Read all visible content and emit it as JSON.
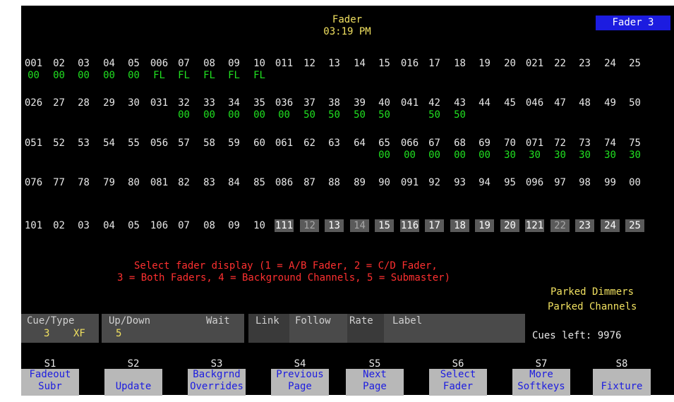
{
  "header": {
    "title": "Fader",
    "time": "03:19 PM",
    "badge": "Fader 3"
  },
  "rows": [
    {
      "channels": [
        "001",
        "02",
        "03",
        "04",
        "05",
        "006",
        "07",
        "08",
        "09",
        "10",
        "011",
        "12",
        "13",
        "14",
        "15",
        "016",
        "17",
        "18",
        "19",
        "20",
        "021",
        "22",
        "23",
        "24",
        "25"
      ],
      "levels": [
        "00",
        "00",
        "00",
        "00",
        "00",
        "FL",
        "FL",
        "FL",
        "FL",
        "FL",
        "",
        "",
        "",
        "",
        "",
        "",
        "",
        "",
        "",
        "",
        "",
        "",
        "",
        "",
        ""
      ]
    },
    {
      "channels": [
        "026",
        "27",
        "28",
        "29",
        "30",
        "031",
        "32",
        "33",
        "34",
        "35",
        "036",
        "37",
        "38",
        "39",
        "40",
        "041",
        "42",
        "43",
        "44",
        "45",
        "046",
        "47",
        "48",
        "49",
        "50"
      ],
      "levels": [
        "",
        "",
        "",
        "",
        "",
        "",
        "00",
        "00",
        "00",
        "00",
        "00",
        "50",
        "50",
        "50",
        "50",
        "",
        "50",
        "50",
        "",
        "",
        "",
        "",
        "",
        "",
        ""
      ]
    },
    {
      "channels": [
        "051",
        "52",
        "53",
        "54",
        "55",
        "056",
        "57",
        "58",
        "59",
        "60",
        "061",
        "62",
        "63",
        "64",
        "65",
        "066",
        "67",
        "68",
        "69",
        "70",
        "071",
        "72",
        "73",
        "74",
        "75"
      ],
      "levels": [
        "",
        "",
        "",
        "",
        "",
        "",
        "",
        "",
        "",
        "",
        "",
        "",
        "",
        "",
        "00",
        "00",
        "00",
        "00",
        "00",
        "30",
        "30",
        "30",
        "30",
        "30",
        "30"
      ]
    },
    {
      "channels": [
        "076",
        "77",
        "78",
        "79",
        "80",
        "081",
        "82",
        "83",
        "84",
        "85",
        "086",
        "87",
        "88",
        "89",
        "90",
        "091",
        "92",
        "93",
        "94",
        "95",
        "096",
        "97",
        "98",
        "99",
        "00"
      ],
      "levels": [
        "",
        "",
        "",
        "",
        "",
        "",
        "",
        "",
        "",
        "",
        "",
        "",
        "",
        "",
        "",
        "",
        "",
        "",
        "",
        "",
        "",
        "",
        "",
        "",
        ""
      ]
    },
    {
      "channels": [
        "101",
        "02",
        "03",
        "04",
        "05",
        "106",
        "07",
        "08",
        "09",
        "10",
        "111",
        "12",
        "13",
        "14",
        "15",
        "116",
        "17",
        "18",
        "19",
        "20",
        "121",
        "22",
        "23",
        "24",
        "25"
      ],
      "levels": [
        "",
        "",
        "",
        "",
        "",
        "",
        "",
        "",
        "",
        "",
        "",
        "",
        "",
        "",
        "",
        "",
        "",
        "",
        "",
        "",
        "",
        "",
        "",
        "",
        ""
      ]
    }
  ],
  "prompt": {
    "line1": "Select fader display (1 = A/B Fader, 2 = C/D Fader,",
    "line2": "3 = Both Faders, 4 = Background Channels, 5 = Submaster)"
  },
  "parked": {
    "dimmers": "Parked Dimmers",
    "channels": "Parked Channels"
  },
  "cuebar": {
    "cue_type_label": "Cue/Type",
    "cue_value": "3",
    "type_value": "XF",
    "updown_label": "Up/Down",
    "updown_value": "5",
    "wait_label": "Wait",
    "link_label": "Link",
    "follow_label": "Follow",
    "rate_label": "Rate",
    "label_label": "Label",
    "cues_left": "Cues left: 9976"
  },
  "softkeys": [
    {
      "id": "S1",
      "line1": "Fadeout",
      "line2": "Subr"
    },
    {
      "id": "S2",
      "line1": "",
      "line2": "Update"
    },
    {
      "id": "S3",
      "line1": "Backgrnd",
      "line2": "Overrides"
    },
    {
      "id": "S4",
      "line1": "Previous",
      "line2": "Page"
    },
    {
      "id": "S5",
      "line1": "Next",
      "line2": "Page"
    },
    {
      "id": "S6",
      "line1": "Select",
      "line2": "Fader"
    },
    {
      "id": "S7",
      "line1": "More",
      "line2": "Softkeys"
    },
    {
      "id": "S8",
      "line1": "",
      "line2": "Fixture"
    }
  ],
  "colors": {
    "background": "#000000",
    "channel": "#e8e8e8",
    "level": "#20e020",
    "prompt": "#ff3030",
    "accent": "#f0e060",
    "badge": "#1c1ce0",
    "softkey": "#b8b8b8"
  }
}
